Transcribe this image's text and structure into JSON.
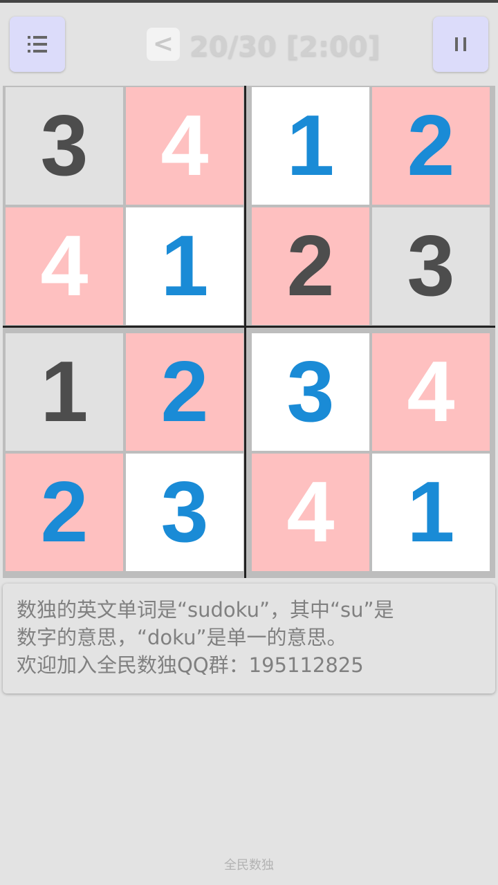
{
  "header": {
    "prev_label": "<",
    "progress": "20/30 [2:00]",
    "menu_icon": "list-icon",
    "pause_icon": "pause-icon"
  },
  "board": {
    "size": 4,
    "cells": [
      {
        "value": "3",
        "bg": "grey",
        "color": "dark"
      },
      {
        "value": "4",
        "bg": "pink",
        "color": "white"
      },
      {
        "value": "1",
        "bg": "white",
        "color": "blue"
      },
      {
        "value": "2",
        "bg": "pink",
        "color": "blue"
      },
      {
        "value": "4",
        "bg": "pink",
        "color": "white"
      },
      {
        "value": "1",
        "bg": "white",
        "color": "blue"
      },
      {
        "value": "2",
        "bg": "pink",
        "color": "dark"
      },
      {
        "value": "3",
        "bg": "grey",
        "color": "dark"
      },
      {
        "value": "1",
        "bg": "grey",
        "color": "dark"
      },
      {
        "value": "2",
        "bg": "pink",
        "color": "blue"
      },
      {
        "value": "3",
        "bg": "white",
        "color": "blue"
      },
      {
        "value": "4",
        "bg": "pink",
        "color": "white"
      },
      {
        "value": "2",
        "bg": "pink",
        "color": "blue"
      },
      {
        "value": "3",
        "bg": "white",
        "color": "blue"
      },
      {
        "value": "4",
        "bg": "pink",
        "color": "white"
      },
      {
        "value": "1",
        "bg": "white",
        "color": "blue"
      }
    ]
  },
  "colors": {
    "pink": "#fec0c0",
    "grey": "#e1e1e1",
    "white": "#ffffff",
    "blue": "#1a8bd6",
    "dark": "#4d4d4d",
    "button": "#dcdcfa"
  },
  "info": {
    "line1": "数独的英文单词是“sudoku”，其中“su”是",
    "line2": "数字的意思，“doku”是单一的意思。",
    "line3": "欢迎加入全民数独QQ群：195112825"
  },
  "footer": {
    "label": "全民数独"
  }
}
